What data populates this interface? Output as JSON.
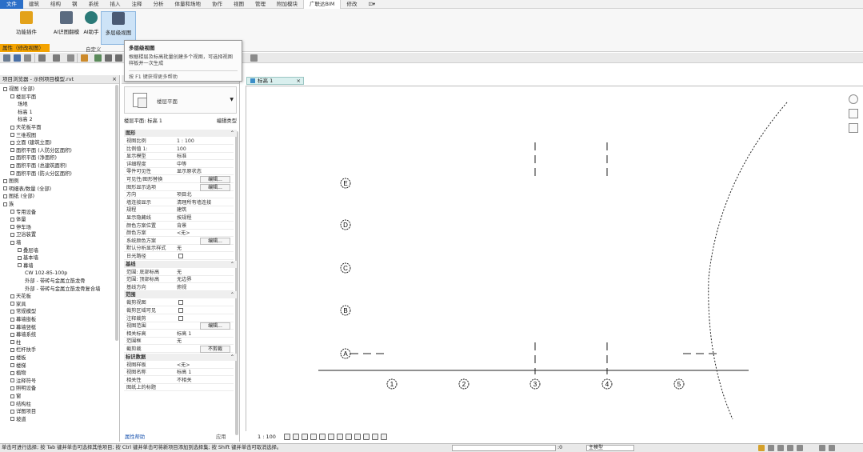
{
  "ribbon_tabs": [
    {
      "label": "文件",
      "state": "file"
    },
    {
      "label": "建筑",
      "state": ""
    },
    {
      "label": "结构",
      "state": ""
    },
    {
      "label": "钢",
      "state": ""
    },
    {
      "label": "系统",
      "state": ""
    },
    {
      "label": "插入",
      "state": ""
    },
    {
      "label": "注释",
      "state": ""
    },
    {
      "label": "分析",
      "state": ""
    },
    {
      "label": "体量和场地",
      "state": ""
    },
    {
      "label": "协作",
      "state": ""
    },
    {
      "label": "视图",
      "state": ""
    },
    {
      "label": "管理",
      "state": ""
    },
    {
      "label": "附加模块",
      "state": ""
    },
    {
      "label": "广联达BIM",
      "state": "active"
    },
    {
      "label": "修改",
      "state": ""
    },
    {
      "label": "⊡▾",
      "state": ""
    }
  ],
  "ribbon_buttons": [
    {
      "label": "功能插件",
      "color": "#e3a21a"
    },
    {
      "label": "AI识图翻模",
      "color": "#5b6b80"
    },
    {
      "label": "AI助手",
      "color": "#2b7a78"
    },
    {
      "label": "多层级视图",
      "color": "#4a5a74"
    }
  ],
  "ribbon_panel_title": "自定义",
  "property_bar": "属性（修改视图）",
  "tooltip": {
    "title": "多层级视图",
    "description": "根据楼层及标高批量创建多个视图，可选择视图样板并一次生成",
    "footer": "按 F1 键获得更多帮助"
  },
  "project_browser": {
    "title": "项目浏览器 - 示例项目模型.rvt",
    "close": "×",
    "items": [
      {
        "label": "视图 (全部)",
        "indent": 0,
        "exp": "□"
      },
      {
        "label": "楼层平面",
        "indent": 1,
        "exp": "□"
      },
      {
        "label": "场地",
        "indent": 2,
        "exp": ""
      },
      {
        "label": "标高 1",
        "indent": 2,
        "exp": ""
      },
      {
        "label": "标高 2",
        "indent": 2,
        "exp": ""
      },
      {
        "label": "天花板平面",
        "indent": 1,
        "exp": "□"
      },
      {
        "label": "三维视图",
        "indent": 1,
        "exp": "□"
      },
      {
        "label": "立面 (建筑立面)",
        "indent": 1,
        "exp": "□"
      },
      {
        "label": "面积平面 (人防分区面积)",
        "indent": 1,
        "exp": "□"
      },
      {
        "label": "面积平面 (净面积)",
        "indent": 1,
        "exp": "□"
      },
      {
        "label": "面积平面 (总建筑面积)",
        "indent": 1,
        "exp": "□"
      },
      {
        "label": "面积平面 (防火分区面积)",
        "indent": 1,
        "exp": "□"
      },
      {
        "label": "图例",
        "indent": 0,
        "exp": "▦"
      },
      {
        "label": "明细表/数量 (全部)",
        "indent": 0,
        "exp": "▦"
      },
      {
        "label": "图纸 (全部)",
        "indent": 0,
        "exp": "▦"
      },
      {
        "label": "族",
        "indent": 0,
        "exp": "□"
      },
      {
        "label": "专用设备",
        "indent": 1,
        "exp": "□"
      },
      {
        "label": "体量",
        "indent": 1,
        "exp": "□"
      },
      {
        "label": "停车场",
        "indent": 1,
        "exp": "□"
      },
      {
        "label": "卫浴装置",
        "indent": 1,
        "exp": "□"
      },
      {
        "label": "墙",
        "indent": 1,
        "exp": "□"
      },
      {
        "label": "叠层墙",
        "indent": 2,
        "exp": "□"
      },
      {
        "label": "基本墙",
        "indent": 2,
        "exp": "□"
      },
      {
        "label": "幕墙",
        "indent": 2,
        "exp": "□"
      },
      {
        "label": "CW 102-85-100p",
        "indent": 3,
        "exp": ""
      },
      {
        "label": "外部 - 带砖与金属立筋龙骨",
        "indent": 3,
        "exp": ""
      },
      {
        "label": "外部 - 带砖与金属立筋龙骨复合墙",
        "indent": 3,
        "exp": ""
      },
      {
        "label": "天花板",
        "indent": 1,
        "exp": "□"
      },
      {
        "label": "家具",
        "indent": 1,
        "exp": "□"
      },
      {
        "label": "常规模型",
        "indent": 1,
        "exp": "□"
      },
      {
        "label": "幕墙嵌板",
        "indent": 1,
        "exp": "□"
      },
      {
        "label": "幕墙竖梃",
        "indent": 1,
        "exp": "□"
      },
      {
        "label": "幕墙系统",
        "indent": 1,
        "exp": "□"
      },
      {
        "label": "柱",
        "indent": 1,
        "exp": "□"
      },
      {
        "label": "栏杆扶手",
        "indent": 1,
        "exp": "□"
      },
      {
        "label": "楼板",
        "indent": 1,
        "exp": "□"
      },
      {
        "label": "楼梯",
        "indent": 1,
        "exp": "□"
      },
      {
        "label": "植物",
        "indent": 1,
        "exp": "□"
      },
      {
        "label": "注释符号",
        "indent": 1,
        "exp": "□"
      },
      {
        "label": "照明设备",
        "indent": 1,
        "exp": "□"
      },
      {
        "label": "窗",
        "indent": 1,
        "exp": "□"
      },
      {
        "label": "结构柱",
        "indent": 1,
        "exp": "□"
      },
      {
        "label": "详图项目",
        "indent": 1,
        "exp": "□"
      },
      {
        "label": "坡道",
        "indent": 1,
        "exp": "□"
      }
    ]
  },
  "properties": {
    "title": "属性",
    "close": "×",
    "type_label": "楼层平面",
    "view_selector": "楼层平面: 标高 1",
    "edit_type": "编辑类型",
    "sections": [
      {
        "title": "图形",
        "rows": [
          {
            "k": "视图比例",
            "v": "1 : 100",
            "box": false
          },
          {
            "k": "比例值 1:",
            "v": "100",
            "box": false
          },
          {
            "k": "显示模型",
            "v": "标准",
            "box": false
          },
          {
            "k": "详细程度",
            "v": "中等",
            "box": false
          },
          {
            "k": "零件可见性",
            "v": "显示原状态",
            "box": false
          },
          {
            "k": "可见性/图形替换",
            "v": "编辑...",
            "box": true
          },
          {
            "k": "图形显示选项",
            "v": "编辑...",
            "box": true
          },
          {
            "k": "方向",
            "v": "项目北",
            "box": false
          },
          {
            "k": "墙连接显示",
            "v": "清理所有墙连接",
            "box": false
          },
          {
            "k": "规程",
            "v": "建筑",
            "box": false
          },
          {
            "k": "显示隐藏线",
            "v": "按规程",
            "box": false
          },
          {
            "k": "颜色方案位置",
            "v": "背景",
            "box": false
          },
          {
            "k": "颜色方案",
            "v": "<无>",
            "box": false
          },
          {
            "k": "系统颜色方案",
            "v": "编辑...",
            "box": true
          },
          {
            "k": "默认分析显示样式",
            "v": "无",
            "box": false
          },
          {
            "k": "日光路径",
            "v": "",
            "cb": true
          }
        ]
      },
      {
        "title": "基线",
        "rows": [
          {
            "k": "范围: 底部标高",
            "v": "无",
            "box": false
          },
          {
            "k": "范围: 顶部标高",
            "v": "无边界",
            "box": false
          },
          {
            "k": "基线方向",
            "v": "俯视",
            "box": false
          }
        ]
      },
      {
        "title": "范围",
        "rows": [
          {
            "k": "裁剪视图",
            "v": "",
            "cb": true
          },
          {
            "k": "裁剪区域可见",
            "v": "",
            "cb": true
          },
          {
            "k": "注释裁剪",
            "v": "",
            "cb": true
          },
          {
            "k": "视图范围",
            "v": "编辑...",
            "box": true
          },
          {
            "k": "相关标高",
            "v": "标高 1",
            "box": false
          },
          {
            "k": "范围框",
            "v": "无",
            "box": false
          },
          {
            "k": "截剪裁",
            "v": "不剪裁",
            "box": true
          }
        ]
      },
      {
        "title": "标识数据",
        "rows": [
          {
            "k": "视图样板",
            "v": "<无>",
            "box": false
          },
          {
            "k": "视图名称",
            "v": "标高 1",
            "box": false
          },
          {
            "k": "相关性",
            "v": "不相关",
            "box": false
          },
          {
            "k": "图纸上的标题",
            "v": "",
            "box": false
          }
        ]
      }
    ],
    "help_link": "属性帮助",
    "apply": "应用"
  },
  "view_tab": {
    "label": "标高 1",
    "close": "×"
  },
  "drawing": {
    "grid_letters": [
      "E",
      "D",
      "C",
      "B",
      "A"
    ],
    "grid_numbers": [
      "1",
      "2",
      "3",
      "4",
      "5"
    ]
  },
  "view_controls": {
    "scale": "1 : 100"
  },
  "status": {
    "message": "单击可进行选择; 按 Tab 键并单击可选择其他项目; 按 Ctrl 键并单击可将新项目添加到选择集; 按 Shift 键并单击可取消选择。",
    "model": "主模型",
    "zero": ":0"
  },
  "colors": {
    "accent": "#2b6fc8",
    "propbar": "#f4a300",
    "viewtab": "#d9efee"
  }
}
